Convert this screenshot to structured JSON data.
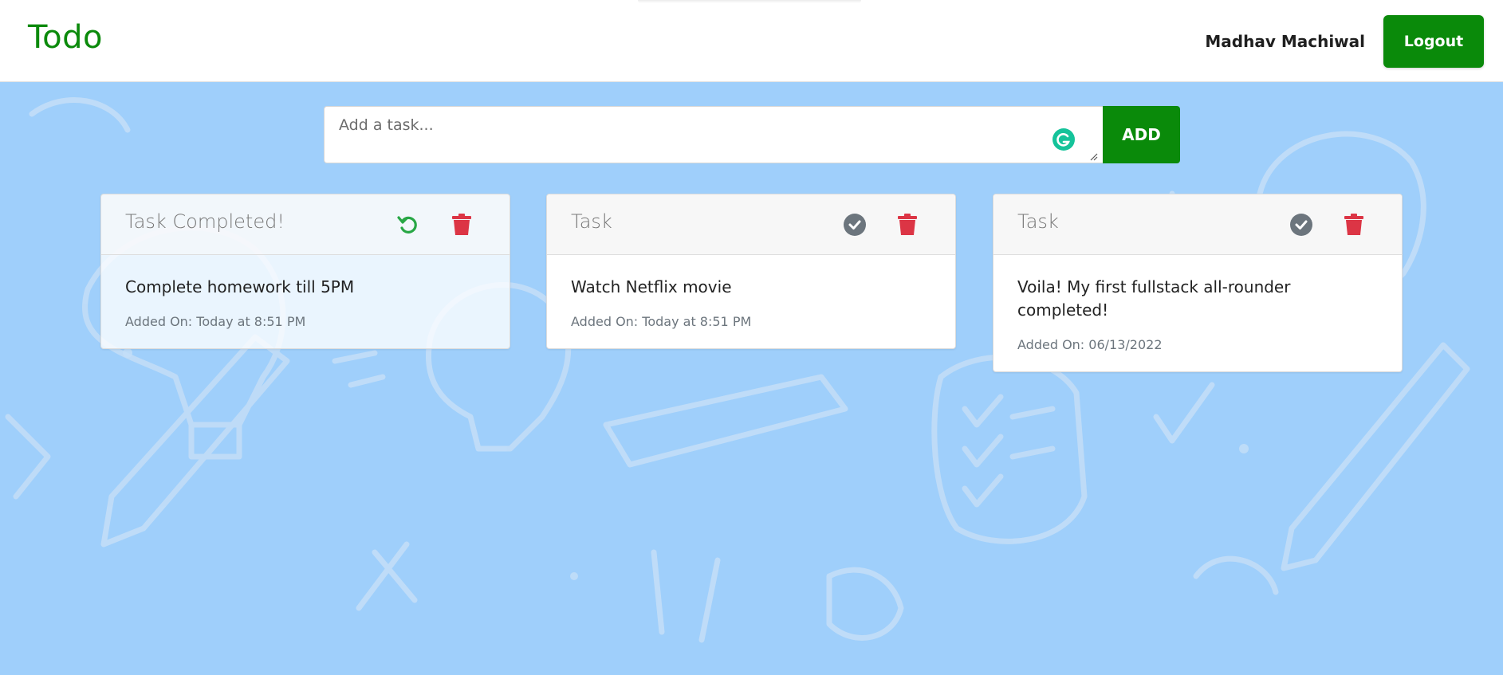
{
  "app": {
    "brand": "Todo"
  },
  "header": {
    "username": "Madhav Machiwal",
    "logout_label": "Logout"
  },
  "form": {
    "placeholder": "Add a task...",
    "add_label": "ADD"
  },
  "colors": {
    "brand_green": "#0a8a0a",
    "delete_red": "#dc3545",
    "undo_green": "#28a745",
    "check_gray": "#6c757d",
    "background_blue": "#9fcffb"
  },
  "cards": [
    {
      "title": "Task Completed!",
      "text": "Complete homework till 5PM",
      "date": "Added On: Today at 8:51 PM",
      "status": "completed",
      "action_icon": "undo-icon"
    },
    {
      "title": "Task",
      "text": "Watch Netflix movie",
      "date": "Added On: Today at 8:51 PM",
      "status": "pending",
      "action_icon": "check-circle-icon"
    },
    {
      "title": "Task",
      "text": "Voila! My first fullstack all-rounder completed!",
      "date": "Added On: 06/13/2022",
      "status": "pending",
      "action_icon": "check-circle-icon"
    }
  ]
}
